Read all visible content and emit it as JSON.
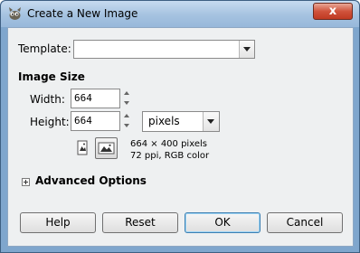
{
  "window": {
    "title": "Create a New Image",
    "close_symbol": "x"
  },
  "template": {
    "label": "Template:",
    "value": ""
  },
  "image_size": {
    "section_label": "Image Size",
    "width_label": "Width:",
    "width_value": "664",
    "height_label": "Height:",
    "height_value": "664",
    "unit_value": "pixels",
    "info_dimensions": "664 × 400 pixels",
    "info_resolution": "72 ppi, RGB color"
  },
  "advanced": {
    "label": "Advanced Options"
  },
  "buttons": {
    "help": "Help",
    "reset": "Reset",
    "ok": "OK",
    "cancel": "Cancel"
  },
  "icons": {
    "app": "gimp-wilber-icon",
    "portrait": "portrait-orientation-icon",
    "landscape": "landscape-orientation-icon"
  }
}
